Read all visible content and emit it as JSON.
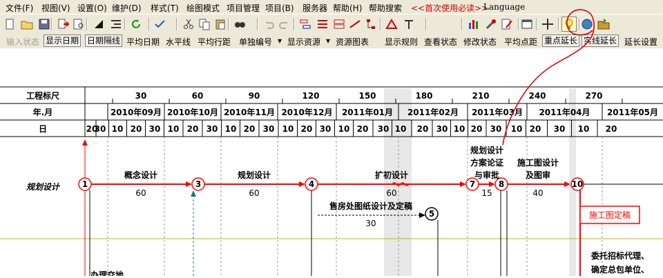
{
  "menu": [
    "文件(F)",
    "视图(V)",
    "设置(O)",
    "维护(D)",
    "样式(T)",
    "绘图模式",
    "项目管理",
    "项目(B)",
    "服务器",
    "帮助(H)",
    "帮助搜索",
    "<<首次使用必读>>",
    "Language"
  ],
  "colors": {
    "chrome": "#ece9d8",
    "activity": "#ff0000",
    "shade": "#e8e8e8",
    "highlight": "#ff0000"
  },
  "toolbar_icons": [
    "new-file-icon",
    "open-folder-icon",
    "save-icon",
    "export-icon",
    "print-preview-icon",
    "triangle-icon",
    "indent-icon",
    "refresh-icon",
    "check-icon",
    "cut-icon",
    "copy-icon",
    "paste-icon",
    "find-icon",
    "undo-icon",
    "redo-icon",
    "link-tasks-icon",
    "split-icon",
    "node-icon",
    "line-icon",
    "network-icon",
    "gantt-icon",
    "align-icon",
    "bar-chart-icon",
    "tools-icon",
    "edit-icon",
    "calendar-icon",
    "crosshair-icon",
    "bulb-icon",
    "globe-icon",
    "folder-open-icon"
  ],
  "viewbar": {
    "input_status": "输入状态",
    "show_date": "显示日期",
    "date_lines": "日期隔线",
    "avg_date": "平均日期",
    "hline": "水平线",
    "avg_row": "平均行距",
    "single_num": "单独编号",
    "show_resource": "显示资源",
    "resource_chart": "资源图表",
    "show_rules": "显示规则",
    "view_status": "查看状态",
    "edit_status": "修改状态",
    "avg_node": "平均点距",
    "key_extend": "重点延长",
    "real_extend": "实线延长",
    "extend_settings": "延长设置"
  },
  "scale": {
    "row1_label": "工程标尺",
    "row2_label": "年.月",
    "row3_label": "日",
    "ruler": [
      "30",
      "60",
      "90",
      "120",
      "150",
      "180",
      "210",
      "240",
      "270"
    ],
    "months": [
      "2010年09月",
      "2010年10月",
      "2010年11月",
      "2010年12月",
      "2011年01月",
      "2011年02月",
      "2011年03月",
      "2011年04月",
      "2011年05月"
    ],
    "days": [
      "20",
      "30",
      "10",
      "20",
      "30",
      "10",
      "20",
      "30",
      "10",
      "20",
      "30",
      "10",
      "20",
      "30",
      "10",
      "20",
      "30",
      "10",
      "20",
      "30",
      "10",
      "20",
      "30",
      "10",
      "20",
      "30",
      "10",
      "20"
    ]
  },
  "network": {
    "group_label": "规划设计",
    "nodes": [
      "1",
      "3",
      "4",
      "5",
      "7",
      "8",
      "10"
    ],
    "activities": {
      "a1_name": "概念设计",
      "a1_dur": "60",
      "a2_name": "规划设计",
      "a2_dur": "60",
      "a3_name": "扩初设计",
      "a3_dur": "60",
      "a4_name1": "规划设计",
      "a4_name2": "方案论证",
      "a4_name3": "与审批",
      "a4_dur": "15",
      "a5_name1": "施工图设计",
      "a5_name2": "及图审",
      "a5_dur": "40",
      "a6_name": "售房处图纸设计及定稿",
      "a6_dur": "30"
    },
    "milestone": "施工图定稿",
    "note_line1": "委托招标代理、",
    "note_line2": "确定总包单位、",
    "bottom_label": "办理交地"
  }
}
